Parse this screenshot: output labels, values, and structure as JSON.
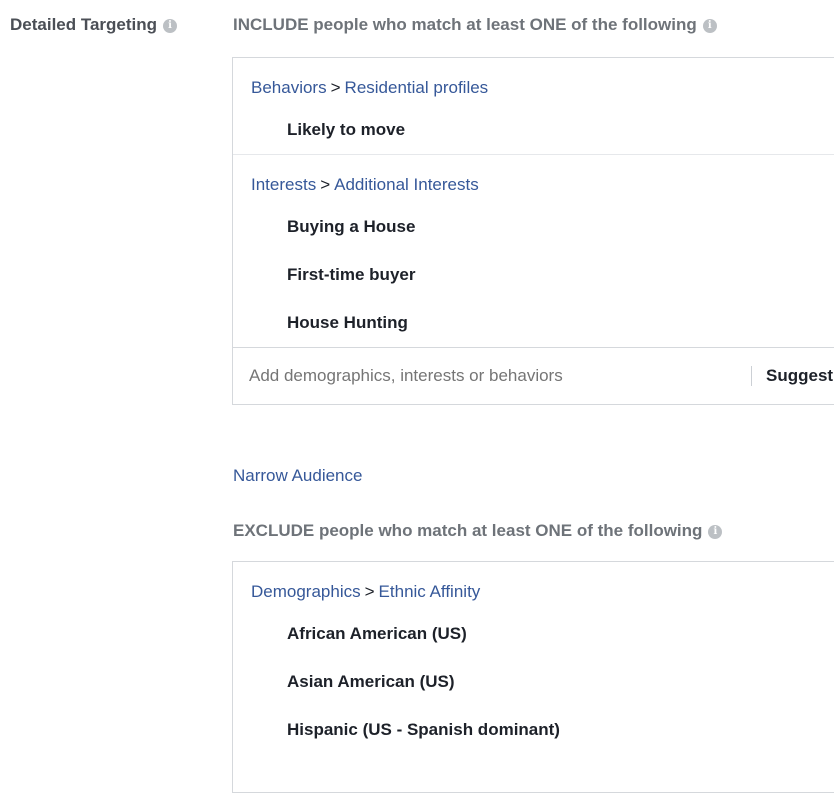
{
  "detailed_targeting": {
    "label": "Detailed Targeting",
    "info_icon": "info-icon"
  },
  "include": {
    "heading": "INCLUDE people who match at least ONE of the following",
    "groups": [
      {
        "category": "Behaviors",
        "separator": ">",
        "subcategory": "Residential profiles",
        "items": [
          "Likely to move"
        ]
      },
      {
        "category": "Interests",
        "separator": ">",
        "subcategory": "Additional Interests",
        "items": [
          "Buying a House",
          "First-time buyer",
          "House Hunting"
        ]
      }
    ],
    "search_placeholder": "Add demographics, interests or behaviors",
    "suggestions_label": "Suggestions"
  },
  "narrow_audience_label": "Narrow Audience",
  "exclude": {
    "heading": "EXCLUDE people who match at least ONE of the following",
    "groups": [
      {
        "category": "Demographics",
        "separator": ">",
        "subcategory": "Ethnic Affinity",
        "items": [
          "African American (US)",
          "Asian American (US)",
          "Hispanic (US - Spanish dominant)"
        ]
      }
    ]
  },
  "colors": {
    "link": "#365899",
    "heading_gray": "#6e7379",
    "border": "#d5d8dc"
  }
}
